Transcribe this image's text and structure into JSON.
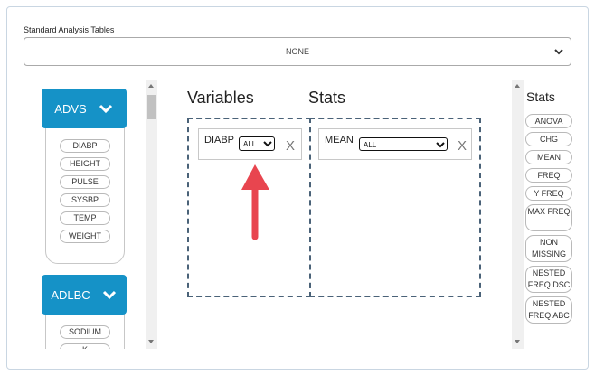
{
  "standard_tables": {
    "label": "Standard Analysis Tables",
    "selected": "NONE"
  },
  "datasets": [
    {
      "name": "ADVS",
      "variables": [
        "DIABP",
        "HEIGHT",
        "PULSE",
        "SYSBP",
        "TEMP",
        "WEIGHT"
      ]
    },
    {
      "name": "ADLBC",
      "variables": [
        "SODIUM",
        "K"
      ]
    }
  ],
  "variables_panel": {
    "title": "Variables",
    "item": {
      "label": "DIABP",
      "select_value": "ALL",
      "remove": "X"
    }
  },
  "stats_panel": {
    "title": "Stats",
    "item": {
      "label": "MEAN",
      "select_value": "ALL",
      "remove": "X"
    }
  },
  "stats_palette": {
    "title": "Stats",
    "items": [
      "ANOVA",
      "CHG",
      "MEAN",
      "FREQ",
      "Y FREQ",
      "MAX FREQ",
      "NON MISSING",
      "NESTED FREQ DSC",
      "NESTED FREQ ABC"
    ]
  },
  "colors": {
    "accent": "#1592c7",
    "annotation_arrow": "#e8454f",
    "dashed_border": "#4a6278"
  },
  "icons": {
    "dataset_toggle": "chevron-down-icon",
    "select": "chevron-down-icon",
    "remove": "close-icon"
  }
}
